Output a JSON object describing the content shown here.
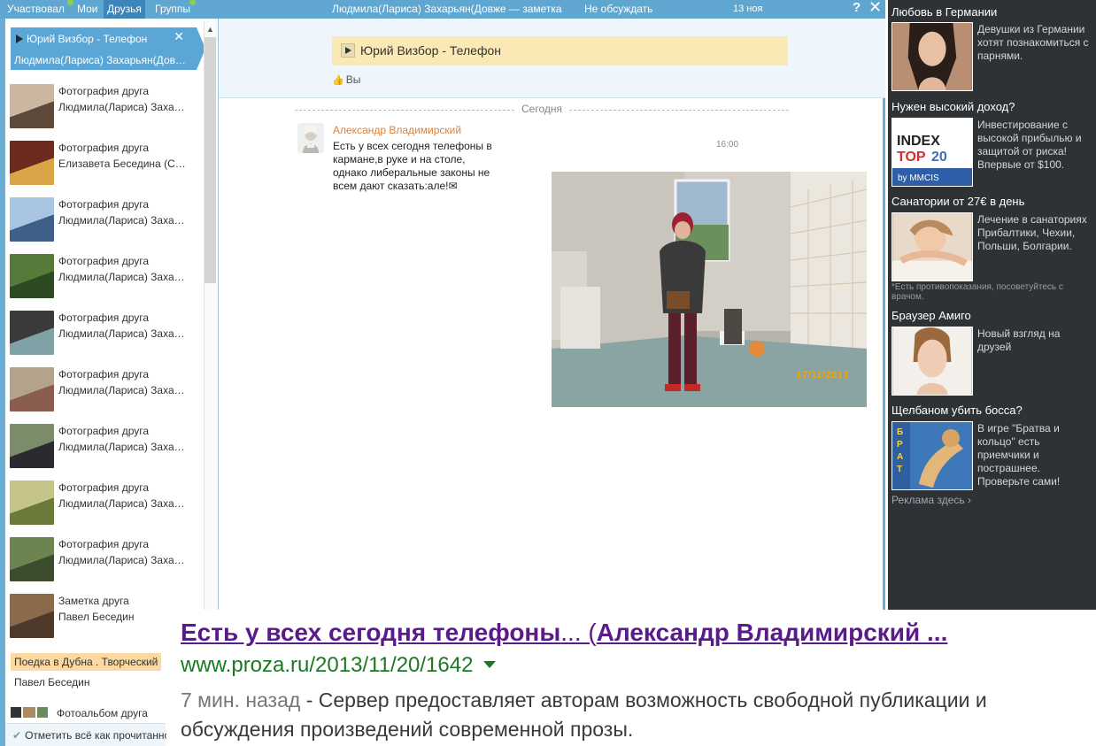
{
  "topnav": {
    "tabs": [
      "Участвовал",
      "Мои",
      "Друзья",
      "Группы"
    ],
    "active_index": 2
  },
  "now_playing": {
    "track": "Юрий Визбор - Телефон",
    "owner": "Людмила(Лариса) Захарьян(Довже — заметка",
    "close_glyph": "✕"
  },
  "feed": [
    {
      "type": "Фотография друга",
      "author": "Людмила(Лариса) Захарьян(Довже"
    },
    {
      "type": "Фотография друга",
      "author": "Елизавета Беседина (Сенцова)"
    },
    {
      "type": "Фотография друга",
      "author": "Людмила(Лариса) Захарьян(Довже"
    },
    {
      "type": "Фотография друга",
      "author": "Людмила(Лариса) Захарьян(Довже"
    },
    {
      "type": "Фотография друга",
      "author": "Людмила(Лариса) Захарьян(Довже"
    },
    {
      "type": "Фотография друга",
      "author": "Людмила(Лариса) Захарьян(Довже"
    },
    {
      "type": "Фотография друга",
      "author": "Людмила(Лариса) Захарьян(Довже"
    },
    {
      "type": "Фотография друга",
      "author": "Людмила(Лариса) Захарьян(Довже"
    },
    {
      "type": "Фотография друга",
      "author": "Людмила(Лариса) Захарьян(Довже"
    },
    {
      "type": "Заметка друга",
      "author": "Павел Беседин"
    }
  ],
  "note": {
    "title": "Поедка в Дубна . Творческий вечер",
    "author": "Павел Беседин"
  },
  "album": {
    "label": "Фотоальбом друга"
  },
  "mark_read": {
    "label": "Отметить всё как прочитанное"
  },
  "conversation": {
    "title": "Людмила(Лариса) Захарьян(Довже — заметка",
    "no_discuss": "Не обсуждать",
    "date": "13 ноя",
    "help": "?",
    "close": "✕",
    "audio_title": "Юрий Визбор - Телефон",
    "likes": "Вы",
    "today": "Сегодня"
  },
  "message": {
    "author": "Александр Владимирский",
    "text": "Есть у всех сегодня телефоны в кармане,в руке и на столе, однако либеральные законы не всем дают сказать:але!✉",
    "time": "16:00",
    "photo_stamp": "17/11/2013"
  },
  "ads": [
    {
      "title": "Любовь в Германии",
      "text": "Девушки из Германии хотят познакомиться с парнями."
    },
    {
      "title": "Нужен высокий доход?",
      "text": "Инвестирование с высокой прибылью и защитой от риска! Впервые от $100.",
      "logo_text": "INDEX TOP 20 by MMCIS"
    },
    {
      "title": "Санатории от 27€ в день",
      "text": "Лечение в санаториях Прибалтики, Чехии, Польши, Болгарии.",
      "note": "*Есть противопоказания, посоветуйтесь с врачом."
    },
    {
      "title": "Браузер Амиго",
      "text": "Новый взгляд на друзей"
    },
    {
      "title": "Щелбаном убить босса?",
      "text": "В игре \"Братва и кольцо\" есть приемчики и пострашнее. Проверьте сами!",
      "logo_text": "БРАТВА"
    }
  ],
  "ads_more": "Реклама здесь ›",
  "search_result": {
    "title_bold1": "Есть у всех сегодня телефоны",
    "title_mid": "... (",
    "title_bold2": "Александр Владимирский ...",
    "url": "www.proza.ru/2013/11/20/1642",
    "age": "7 мин. назад",
    "desc": " - Сервер предоставляет авторам возможность свободной публикации и обсуждения произведений современной прозы."
  },
  "colors": {
    "nav_blue": "#5fa6d1",
    "author_orange": "#d9833f",
    "serp_title": "#5a1a8c",
    "serp_url": "#1a7a21",
    "ads_bg": "#2f3234"
  }
}
